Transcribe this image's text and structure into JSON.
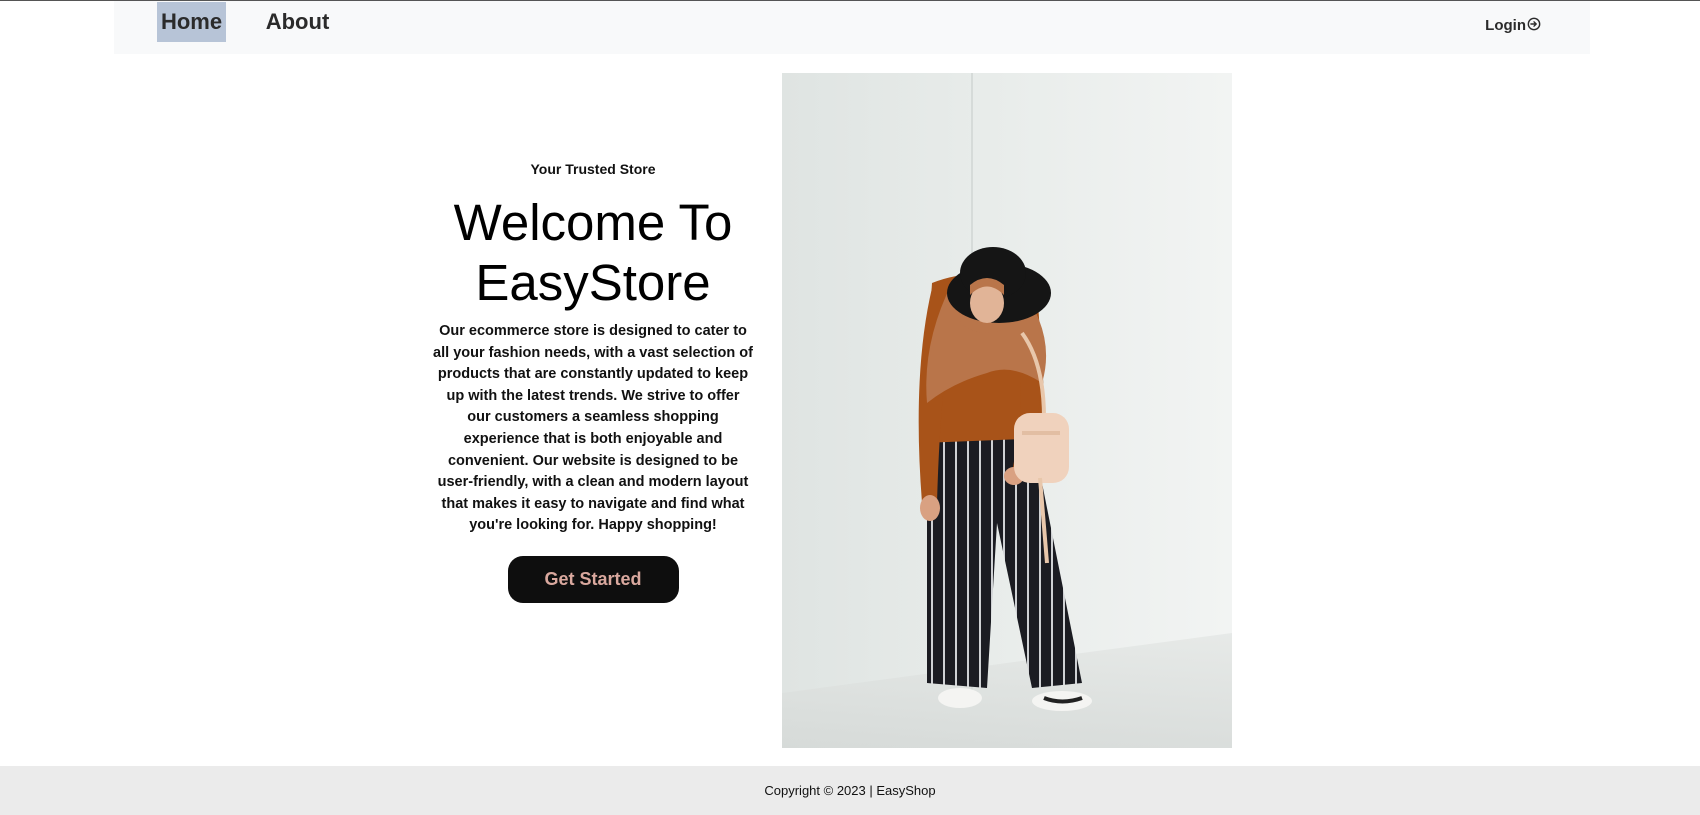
{
  "nav": {
    "links": [
      {
        "label": "Home"
      },
      {
        "label": "About"
      }
    ],
    "login_label": "Login",
    "login_icon": "login-circle-arrow-icon"
  },
  "hero": {
    "tagline": "Your Trusted Store",
    "title": "Welcome To EasyStore",
    "description": "Our ecommerce store is designed to cater to all your fashion needs, with a vast selection of products that are constantly updated to keep up with the latest trends. We strive to offer our customers a seamless shopping experience that is both enjoyable and convenient. Our website is designed to be user-friendly, with a clean and modern layout that makes it easy to navigate and find what you're looking for. Happy shopping!",
    "cta_label": "Get Started",
    "image": "fashion-model-photo"
  },
  "footer": {
    "copyright": "Copyright © 2023 | EasyShop"
  },
  "colors": {
    "nav_bg": "#f8f9fa",
    "nav_active_bg": "#b7c4d7",
    "cta_bg": "#0e0e0e",
    "cta_text": "#d9a89e",
    "footer_bg": "#ebebeb"
  }
}
